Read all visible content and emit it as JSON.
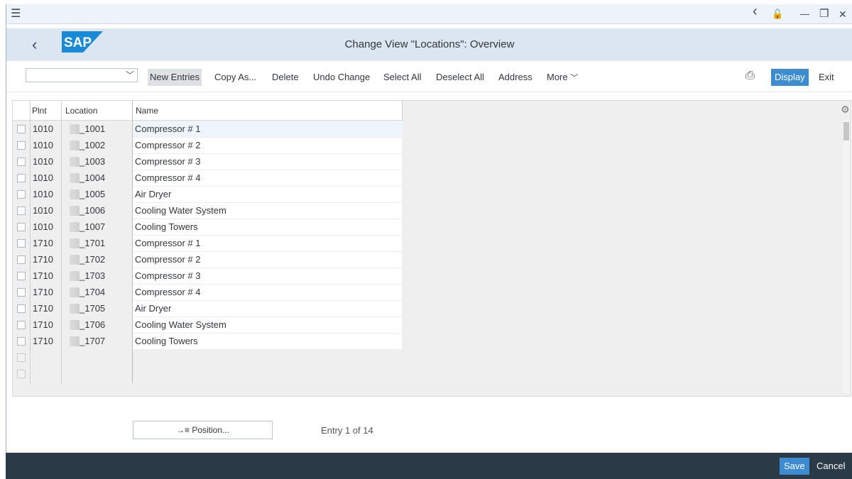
{
  "window": {
    "menu_icon": "☰",
    "nav_back_icon": "‹",
    "lock_icon": "🔓",
    "min_icon": "—",
    "max_icon": "❐",
    "close_icon": "✕"
  },
  "header": {
    "title": "Change View \"Locations\": Overview",
    "logo_text": "SAP",
    "back_icon": "‹"
  },
  "toolbar": {
    "combo_value": "",
    "buttons": {
      "new_entries": "New Entries",
      "copy_as": "Copy As...",
      "delete": "Delete",
      "undo_change": "Undo Change",
      "select_all": "Select All",
      "deselect_all": "Deselect All",
      "address": "Address",
      "more": "More",
      "display": "Display",
      "exit": "Exit"
    },
    "more_chevron": "﹀",
    "print_icon": "⎙"
  },
  "table": {
    "headers": {
      "plnt": "Plnt",
      "location": "Location",
      "name": "Name"
    },
    "rows": [
      {
        "plnt": "1010",
        "location": "_1001",
        "name": "Compressor # 1"
      },
      {
        "plnt": "1010",
        "location": "_1002",
        "name": "Compressor # 2"
      },
      {
        "plnt": "1010",
        "location": "_1003",
        "name": "Compressor # 3"
      },
      {
        "plnt": "1010",
        "location": "_1004",
        "name": "Compressor # 4"
      },
      {
        "plnt": "1010",
        "location": "_1005",
        "name": "Air Dryer"
      },
      {
        "plnt": "1010",
        "location": "_1006",
        "name": "Cooling Water System"
      },
      {
        "plnt": "1010",
        "location": "_1007",
        "name": "Cooling Towers"
      },
      {
        "plnt": "1710",
        "location": "_1701",
        "name": "Compressor # 1"
      },
      {
        "plnt": "1710",
        "location": "_1702",
        "name": "Compressor # 2"
      },
      {
        "plnt": "1710",
        "location": "_1703",
        "name": "Compressor # 3"
      },
      {
        "plnt": "1710",
        "location": "_1704",
        "name": "Compressor # 4"
      },
      {
        "plnt": "1710",
        "location": "_1705",
        "name": "Air Dryer"
      },
      {
        "plnt": "1710",
        "location": "_1706",
        "name": "Cooling Water System"
      },
      {
        "plnt": "1710",
        "location": "_1707",
        "name": "Cooling Towers"
      }
    ],
    "settings_icon": "⚙"
  },
  "position_button": "→≡ Position...",
  "entry_status": "Entry 1 of 14",
  "footer": {
    "save": "Save",
    "cancel": "Cancel"
  },
  "colors": {
    "header_bg": "#dbe6f0",
    "accent": "#3d8bd1",
    "footer_bg": "#2b3a47",
    "sap_logo": "#1a8ad6"
  }
}
